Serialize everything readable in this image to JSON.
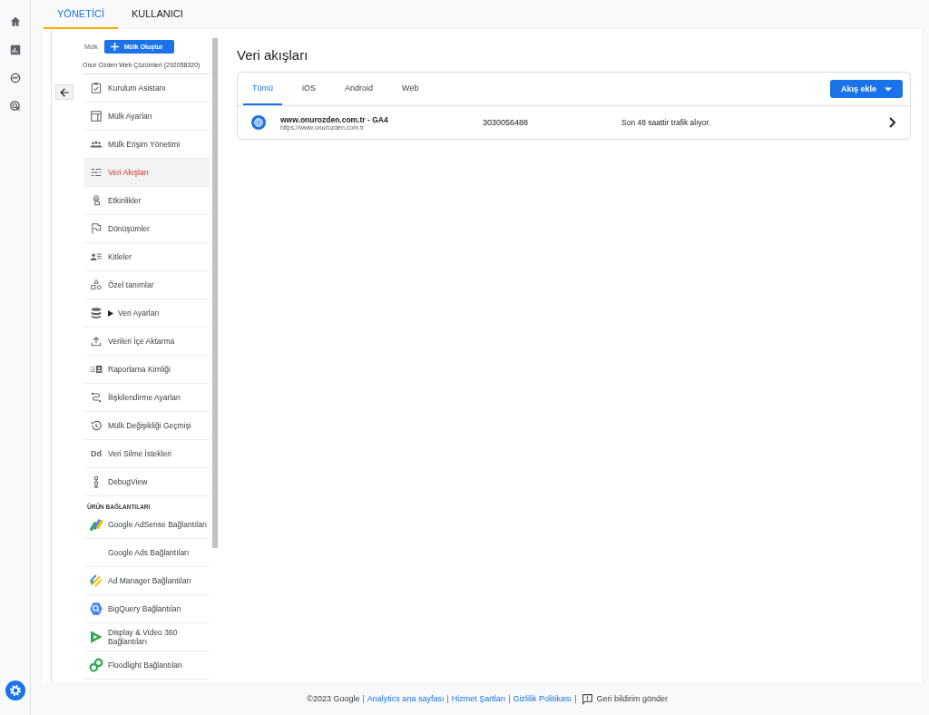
{
  "top_tabs": [
    {
      "label": "YÖNETİCİ",
      "selected": true
    },
    {
      "label": "KULLANICI",
      "selected": false
    }
  ],
  "property": {
    "label": "Mülk",
    "create_button": "Mülk Oluştur",
    "name": "Onur Ozden Web Çözümleri (292058320)"
  },
  "nav_items": [
    {
      "label": "Kurulum Asistanı",
      "selected": false
    },
    {
      "label": "Mülk Ayarları",
      "selected": false
    },
    {
      "label": "Mülk Erişim Yönetimi",
      "selected": false
    },
    {
      "label": "Veri Akışları",
      "selected": true
    },
    {
      "label": "Etkinlikler",
      "selected": false
    },
    {
      "label": "Dönüşümler",
      "selected": false
    },
    {
      "label": "Kitleler",
      "selected": false
    },
    {
      "label": "Özel tanımlar",
      "selected": false
    },
    {
      "label": "Veri Ayarları",
      "selected": false,
      "expanded": false
    },
    {
      "label": "Verileri İçe Aktarma",
      "selected": false
    },
    {
      "label": "Raporlama Kimliği",
      "selected": false
    },
    {
      "label": "İlişkilendirme Ayarları",
      "selected": false
    },
    {
      "label": "Mülk Değişikliği Geçmişi",
      "selected": false
    },
    {
      "label": "Veri Silme İstekleri",
      "selected": false,
      "icon_text": "Dd"
    },
    {
      "label": "DebugView",
      "selected": false
    }
  ],
  "product_links": {
    "heading": "ÜRÜN BAĞLANTILARI",
    "items": [
      {
        "label": "Google AdSense Bağlantıları",
        "selected": false
      },
      {
        "label": "Google Ads Bağlantıları",
        "selected": false
      },
      {
        "label": "Ad Manager Bağlantıları",
        "selected": false
      },
      {
        "label": "BigQuery Bağlantıları",
        "selected": false
      },
      {
        "label": "Display & Video 360 Bağlantıları",
        "selected": false
      },
      {
        "label": "Floodlight Bağlantıları",
        "selected": false
      }
    ]
  },
  "page_title": "Veri akışları",
  "stream_tabs": [
    {
      "label": "Tümü",
      "selected": true
    },
    {
      "label": "iOS",
      "selected": false
    },
    {
      "label": "Android",
      "selected": false
    },
    {
      "label": "Web",
      "selected": false
    }
  ],
  "add_button": "Akış ekle",
  "streams": [
    {
      "name": "www.onurozden.com.tr - GA4",
      "url": "https://www.onurozden.com.tr",
      "id": "3030056488",
      "status": "Son 48 saattir trafik alıyor."
    }
  ],
  "footer": {
    "separator": "|",
    "items": [
      {
        "text": "©2023 Google",
        "kind": "text"
      },
      {
        "text": "Analytics ana sayfası",
        "kind": "link"
      },
      {
        "text": "Hizmet Şartları",
        "kind": "link"
      },
      {
        "text": "Gizlilik Politikası",
        "kind": "link"
      },
      {
        "text": "Geri bildirim gönder",
        "kind": "feedback"
      }
    ]
  }
}
